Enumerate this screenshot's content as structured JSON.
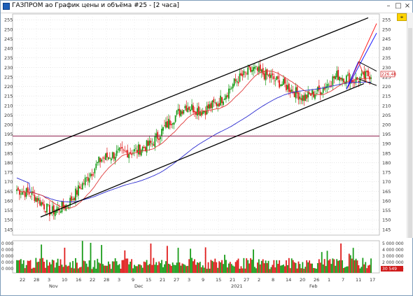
{
  "window": {
    "title": "ГАЗПРОМ ао График цены и объёма #25 - [2 часа]",
    "minimize": "–",
    "maximize": "□",
    "close": "×"
  },
  "toolbar": {
    "pin_icon": "pin-icon"
  },
  "price_axis": {
    "ticks": [
      "255",
      "250",
      "245",
      "240",
      "235",
      "230",
      "225",
      "220",
      "215",
      "210",
      "205",
      "200",
      "195",
      "190",
      "185",
      "180",
      "175",
      "170",
      "165",
      "160",
      "155",
      "150",
      "145"
    ],
    "current_price": "226.48"
  },
  "volume_axis": {
    "left_ticks": [
      "0 000",
      "0 000",
      "0 000",
      "0 000",
      "0 000"
    ],
    "right_ticks": [
      "5 000 000",
      "4 000 000",
      "3 000 000",
      "2 000 000",
      "1 000 000"
    ],
    "current_volume": "30 549"
  },
  "time_axis": {
    "days": [
      "22",
      "28",
      "3",
      "10",
      "16",
      "22",
      "28",
      "3",
      "9",
      "15",
      "21",
      "27",
      "3",
      "9",
      "15",
      "21",
      "27",
      "2",
      "8",
      "14",
      "20",
      "26",
      "1",
      "7",
      "11",
      "17"
    ],
    "months": [
      "Nov",
      "Dec",
      "2021",
      "Feb"
    ]
  },
  "colors": {
    "bull": "#1a9c1a",
    "bear": "#e01c1c",
    "ma_short": "#e03a3a",
    "ma_long": "#2b2bd0",
    "channel": "#000000",
    "level": "#8b1a4a",
    "fan_red": "#ff2020",
    "fan_blue": "#1a1aff",
    "price_tag": "#d01c1c"
  },
  "chart_data": {
    "type": "candlestick",
    "title": "ГАЗПРОМ ао График цены и объёма #25 - [2 часа]",
    "ylim": [
      142,
      258
    ],
    "horizontal_level": 194,
    "last_price": 226.48,
    "last_volume": 30549,
    "price_path": [
      {
        "date": "Oct 22",
        "close": 166
      },
      {
        "date": "Oct 26",
        "close": 163
      },
      {
        "date": "Oct 28",
        "close": 154
      },
      {
        "date": "Nov 3",
        "close": 158
      },
      {
        "date": "Nov 10",
        "close": 170
      },
      {
        "date": "Nov 16",
        "close": 182
      },
      {
        "date": "Nov 22",
        "close": 185
      },
      {
        "date": "Nov 28",
        "close": 186
      },
      {
        "date": "Dec 3",
        "close": 190
      },
      {
        "date": "Dec 9",
        "close": 201
      },
      {
        "date": "Dec 15",
        "close": 210
      },
      {
        "date": "Dec 21",
        "close": 207
      },
      {
        "date": "Dec 27",
        "close": 212
      },
      {
        "date": "Jan 3",
        "close": 223
      },
      {
        "date": "Jan 9",
        "close": 229
      },
      {
        "date": "Jan 15",
        "close": 225
      },
      {
        "date": "Jan 21",
        "close": 220
      },
      {
        "date": "Jan 27",
        "close": 214
      },
      {
        "date": "Feb 2",
        "close": 218
      },
      {
        "date": "Feb 8",
        "close": 226
      },
      {
        "date": "Feb 11",
        "close": 223
      },
      {
        "date": "Feb 17",
        "close": 226.48
      }
    ]
  }
}
